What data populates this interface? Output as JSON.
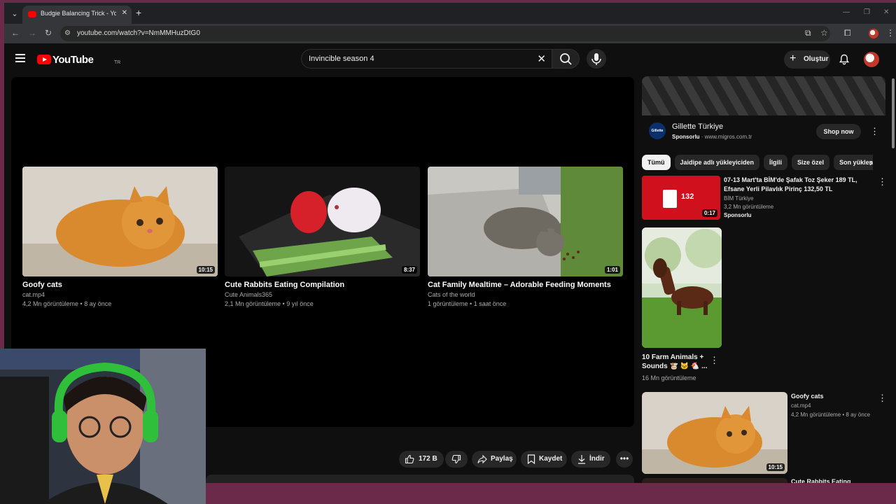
{
  "browser": {
    "tab_title": "Budgie Balancing Trick - YouTube",
    "url": "youtube.com/watch?v=NmMMHuzDtG0"
  },
  "header": {
    "logo_text": "YouTube",
    "country_code": "TR",
    "search_value": "Invincible season 4",
    "create_label": "Oluştur"
  },
  "end_screen": [
    {
      "title": "Goofy cats",
      "channel": "cat.mp4",
      "stats": "4,2 Mn görüntüleme • 8 ay önce",
      "duration": "10:15"
    },
    {
      "title": "Cute Rabbits Eating Compilation",
      "channel": "Cute Animals365",
      "stats": "2,1 Mn görüntüleme • 9 yıl önce",
      "duration": "8:37"
    },
    {
      "title": "Cat Family Mealtime – Adorable Feeding Moments",
      "channel": "Cats of the world",
      "stats": "1 görüntüleme • 1 saat önce",
      "duration": "1:01"
    }
  ],
  "actions": {
    "likes": "172 B",
    "share": "Paylaş",
    "save": "Kaydet",
    "download": "İndir"
  },
  "ad": {
    "logo": "Gillette",
    "name": "Gillette Türkiye",
    "sponsored": "Sponsorlu",
    "domain": "www.migros.com.tr",
    "cta": "Shop now"
  },
  "chips": [
    "Tümü",
    "Jaidipe adlı yükleyiciden",
    "İlgili",
    "Size özel",
    "Son yüklenenler"
  ],
  "related": [
    {
      "title": "07-13 Mart'ta BİM'de Şafak Toz Şeker 189 TL, Efsane Yerli Pilavlık Pirinç 132,50 TL",
      "channel": "BİM Türkiye",
      "stats": "3,2 Mn görüntüleme",
      "badge": "Sponsorlu",
      "duration": "0:17",
      "price": "132"
    },
    {
      "title": "10 Farm Animals + Sounds 🐮 🐱 🐔 ...",
      "stats": "16 Mn görüntüleme"
    },
    {
      "title": "Goofy cats",
      "channel": "cat.mp4",
      "stats": "4,2 Mn görüntüleme • 8 ay önce",
      "duration": "10:15"
    },
    {
      "title": "Cute Rabbits Eating"
    }
  ],
  "colors": {
    "accent": "#ff0000",
    "background": "#0f0f0f",
    "surface": "#272727"
  }
}
